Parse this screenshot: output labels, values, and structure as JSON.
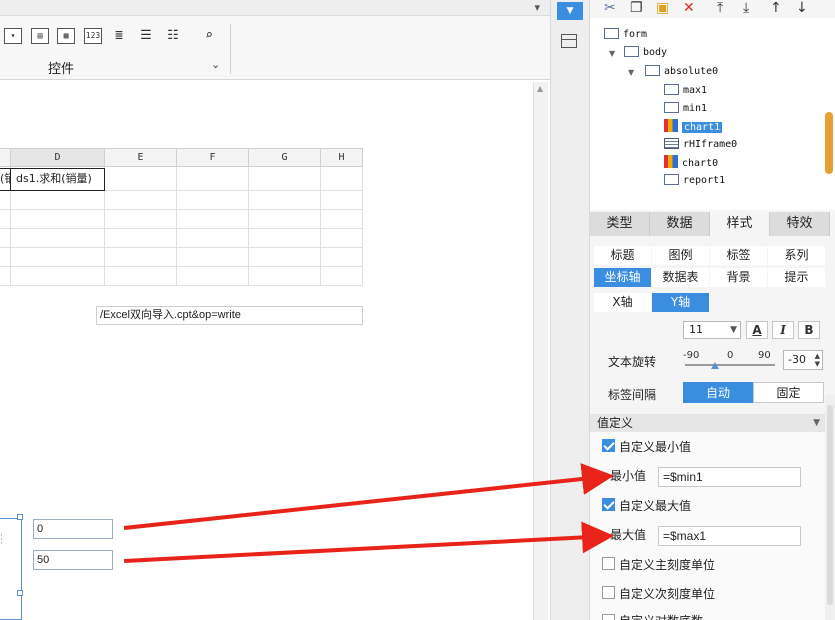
{
  "toolbar": {
    "group_label": "控件",
    "icons": [
      "dropdown-field-icon",
      "form-field-icon",
      "calendar-icon",
      "number-field-icon",
      "text-area-icon",
      "radio-group-icon",
      "checkbox-group-icon",
      "search-doc-icon"
    ],
    "number_icon_text": "123"
  },
  "sheet": {
    "columns": [
      "D",
      "E",
      "F",
      "G",
      "H"
    ],
    "cell_c1": "(销量)",
    "cell_d1": "ds1.求和(销量)",
    "url_text": "/Excel双向导入.cpt&op=write"
  },
  "widgets": {
    "min_value": "0",
    "max_value": "50"
  },
  "tree": {
    "nodes": [
      {
        "label": "form",
        "level": 0
      },
      {
        "label": "body",
        "level": 1
      },
      {
        "label": "absolute0",
        "level": 2
      },
      {
        "label": "max1",
        "level": 3
      },
      {
        "label": "min1",
        "level": 3
      },
      {
        "label": "chart1",
        "level": 3,
        "selected": true
      },
      {
        "label": "rHIframe0",
        "level": 3
      },
      {
        "label": "chart0",
        "level": 3
      },
      {
        "label": "report1",
        "level": 3
      }
    ]
  },
  "tabs": {
    "main": [
      "类型",
      "数据",
      "样式",
      "特效"
    ],
    "active_main": "样式",
    "sub_row1": [
      "标题",
      "图例",
      "标签",
      "系列"
    ],
    "sub_row2": [
      "坐标轴",
      "数据表",
      "背景",
      "提示"
    ],
    "active_sub": "坐标轴",
    "axis": [
      "X轴",
      "Y轴"
    ],
    "active_axis": "Y轴"
  },
  "style": {
    "font_size": "11",
    "color_btn": "A",
    "italic_btn": "I",
    "bold_btn": "B",
    "rotation_label": "文本旋转",
    "rotation_ticks": [
      "-90",
      "0",
      "90"
    ],
    "rotation_value": "-30",
    "interval_label": "标签间隔",
    "interval_auto": "自动",
    "interval_fixed": "固定"
  },
  "value_def": {
    "section_title": "值定义",
    "custom_min_label": "自定义最小值",
    "custom_min_checked": true,
    "min_label": "最小值",
    "min_value": "=$min1",
    "custom_max_label": "自定义最大值",
    "custom_max_checked": true,
    "max_label": "最大值",
    "max_value": "=$max1",
    "custom_major_label": "自定义主刻度单位",
    "custom_minor_label": "自定义次刻度单位",
    "custom_log_label": "自定义对数底数"
  },
  "colors": {
    "accent": "#3b8de0",
    "arrow": "#e8231a"
  }
}
